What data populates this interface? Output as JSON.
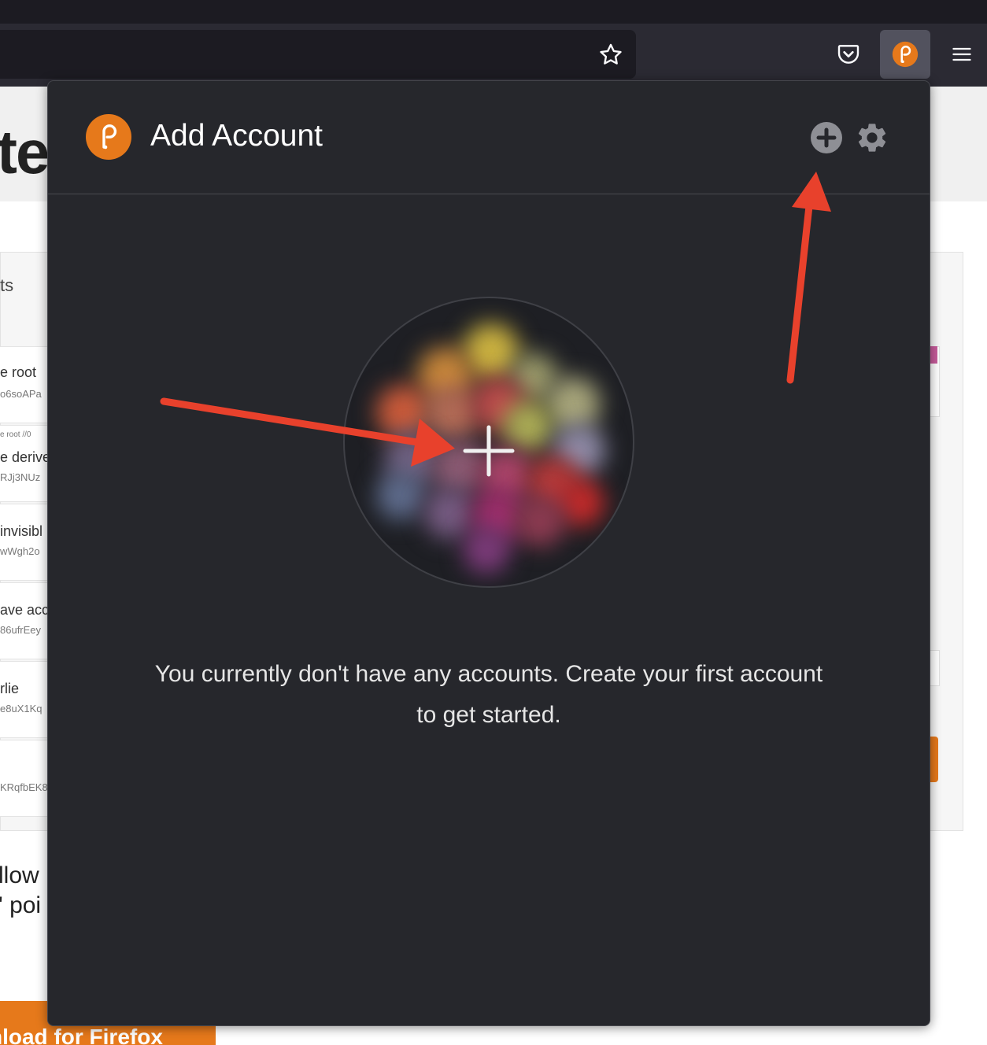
{
  "browser": {
    "icons": {
      "bookmark": "star-icon",
      "pocket": "pocket-icon",
      "extension": "polkadot-extension-icon",
      "menu": "hamburger-menu-icon"
    }
  },
  "background_page": {
    "hero_fragment": "ter",
    "panel_heading_fragment": "ts",
    "rows": [
      {
        "name": "e root",
        "address": "o6soAPa"
      },
      {
        "sub": "e root  //0",
        "name": "e derive",
        "address": "RJj3NUz"
      },
      {
        "name": "invisibl",
        "address": "wWgh2o"
      },
      {
        "name": "ave acc",
        "address": "86ufrEey"
      },
      {
        "name": "rlie",
        "address": "e8uX1Kq"
      },
      {
        "name": "",
        "address": "KRqfbEK8"
      }
    ],
    "text_line_1": "llow",
    "text_line_2": "' poi",
    "download_button": "nload for Firefox"
  },
  "popup": {
    "title": "Add Account",
    "empty_message": "You currently don't have any accounts. Create your first account to get started.",
    "icons": {
      "logo": "polkadot-logo-icon",
      "add": "plus-circle-icon",
      "settings": "gear-icon",
      "create": "plus-icon"
    }
  },
  "annotations": {
    "arrow_color": "#e8412c"
  },
  "colors": {
    "accent": "#e6791b",
    "popup_bg": "#26272c",
    "toolbar_bg": "#2b2a33"
  }
}
